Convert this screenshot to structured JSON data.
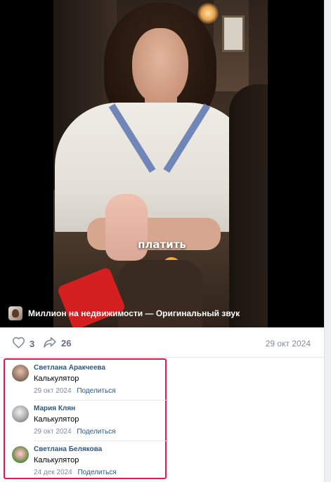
{
  "video": {
    "subtitle": "платить",
    "audio_label": "Миллион на недвижимости — Оригинальный звук"
  },
  "actions": {
    "likes": "3",
    "shares": "26",
    "date": "29 окт 2024"
  },
  "comments": [
    {
      "author": "Светлана Аракчеева",
      "text": "Калькулятор",
      "date": "29 окт 2024",
      "share_label": "Поделиться"
    },
    {
      "author": "Мария Клян",
      "text": "Калькулятор",
      "date": "29 окт 2024",
      "share_label": "Поделиться"
    },
    {
      "author": "Светлана Белякова",
      "text": "Калькулятор",
      "date": "24 дек 2024",
      "share_label": "Поделиться"
    }
  ],
  "colors": {
    "highlight_border": "#e8174c",
    "link": "#2a5885",
    "muted": "#818c99"
  }
}
